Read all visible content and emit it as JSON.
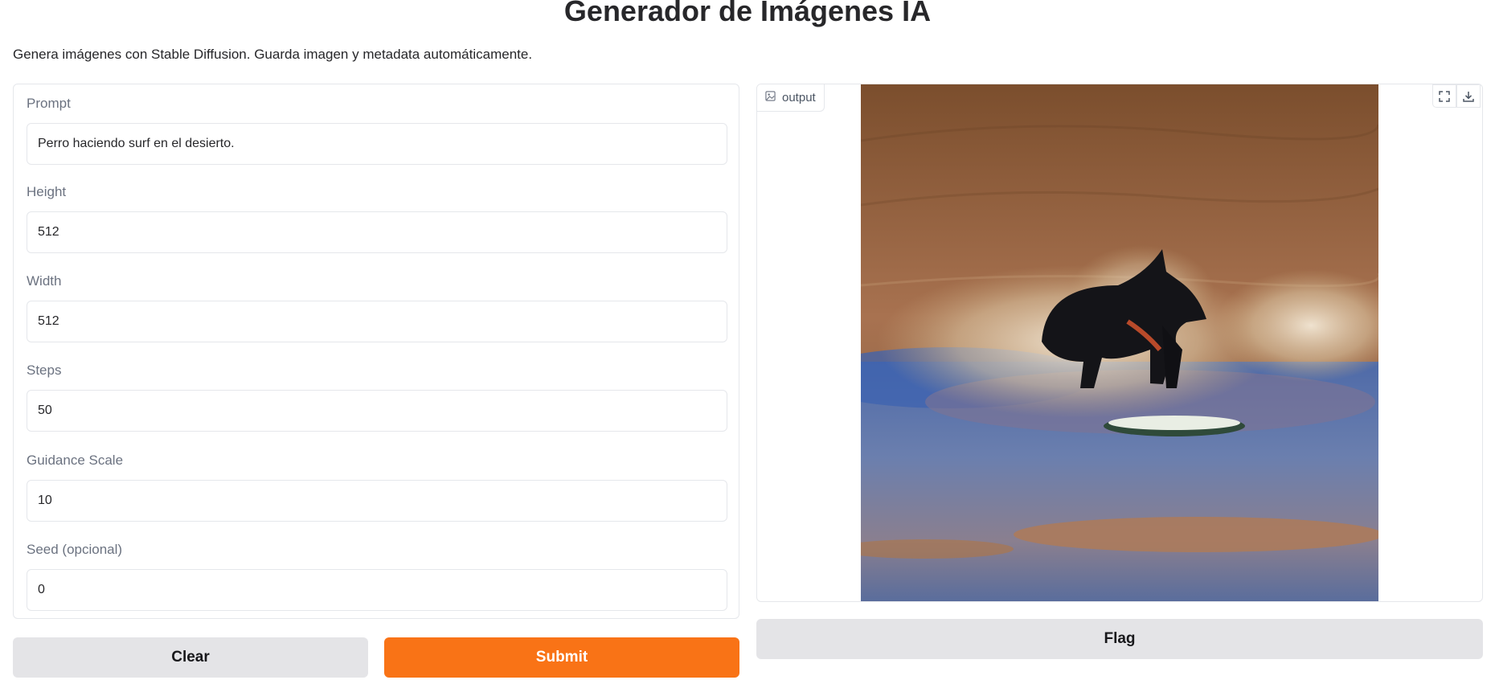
{
  "header": {
    "title": "Generador de Imágenes IA",
    "description": "Genera imágenes con Stable Diffusion. Guarda imagen y metadata automáticamente."
  },
  "form": {
    "prompt": {
      "label": "Prompt",
      "value": "Perro haciendo surf en el desierto."
    },
    "height": {
      "label": "Height",
      "value": "512"
    },
    "width": {
      "label": "Width",
      "value": "512"
    },
    "steps": {
      "label": "Steps",
      "value": "50"
    },
    "guidance": {
      "label": "Guidance Scale",
      "value": "10"
    },
    "seed": {
      "label": "Seed (opcional)",
      "value": "0"
    }
  },
  "actions": {
    "clear": "Clear",
    "submit": "Submit",
    "flag": "Flag"
  },
  "output": {
    "label": "output",
    "icons": [
      "image-icon",
      "fullscreen-icon",
      "download-icon"
    ]
  },
  "colors": {
    "primary": "#f97316",
    "secondary": "#e4e4e7",
    "border": "#e5e7eb"
  }
}
